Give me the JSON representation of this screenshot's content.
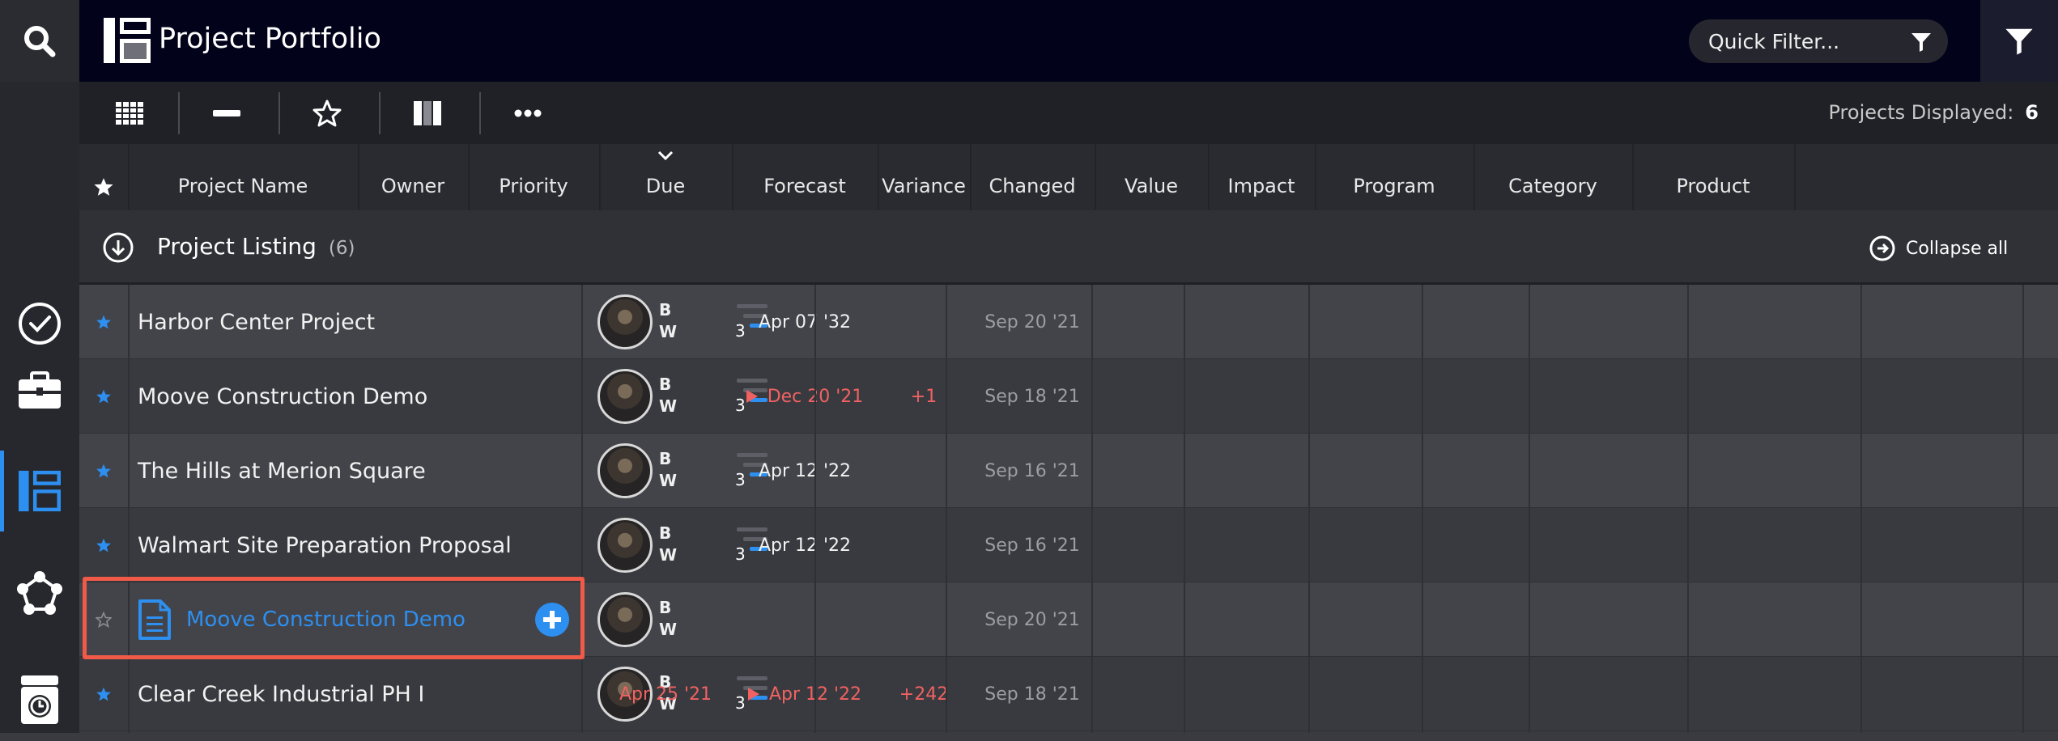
{
  "app": {
    "title": "Project Portfolio"
  },
  "quick_filter": {
    "placeholder": "Quick Filter..."
  },
  "toolbar": {
    "projects_displayed_label": "Projects Displayed:",
    "projects_displayed_count": "6"
  },
  "columns": [
    "Project Name",
    "Owner",
    "Priority",
    "Due",
    "Forecast",
    "Variance",
    "Changed",
    "Value",
    "Impact",
    "Program",
    "Category",
    "Product"
  ],
  "group": {
    "title": "Project Listing",
    "count": "(6)",
    "collapse_label": "Collapse all"
  },
  "rows": [
    {
      "name": "Harbor Center Project",
      "owner": "B W",
      "priority": "3",
      "due": "",
      "forecast": "Apr 07 '32",
      "variance": "",
      "changed": "Sep 20 '21"
    },
    {
      "name": "Moove Construction Demo",
      "owner": "B W",
      "priority": "3",
      "due": "",
      "forecast": "Dec 20 '21",
      "variance": "+1",
      "changed": "Sep 18 '21"
    },
    {
      "name": "The Hills at Merion Square",
      "owner": "B W",
      "priority": "3",
      "due": "",
      "forecast": "Apr 12 '22",
      "variance": "",
      "changed": "Sep 16 '21"
    },
    {
      "name": "Walmart Site Preparation Proposal",
      "owner": "B W",
      "priority": "3",
      "due": "",
      "forecast": "Apr 12 '22",
      "variance": "",
      "changed": "Sep 16 '21"
    },
    {
      "name": "Moove Construction Demo",
      "owner": "B W",
      "priority": "",
      "due": "",
      "forecast": "",
      "variance": "",
      "changed": "Sep 20 '21"
    },
    {
      "name": "Clear Creek Industrial PH I",
      "owner": "B W",
      "priority": "3",
      "due": "Apr 25 '21",
      "forecast": "Apr 12 '22",
      "variance": "+242",
      "changed": "Sep 18 '21"
    }
  ],
  "colors": {
    "accent": "#2d8ff0",
    "overdue": "#f06262",
    "highlight": "#f05a47",
    "topbar": "#02021a"
  },
  "icons": [
    "search-icon",
    "app-logo-icon",
    "filter-icon",
    "grid-icon",
    "minus-icon",
    "star-icon",
    "columns-icon",
    "more-icon",
    "check-circle-icon",
    "briefcase-icon",
    "portfolio-icon",
    "network-icon",
    "timer-icon",
    "collapse-arrow-icon",
    "document-icon",
    "add-circle-icon"
  ]
}
